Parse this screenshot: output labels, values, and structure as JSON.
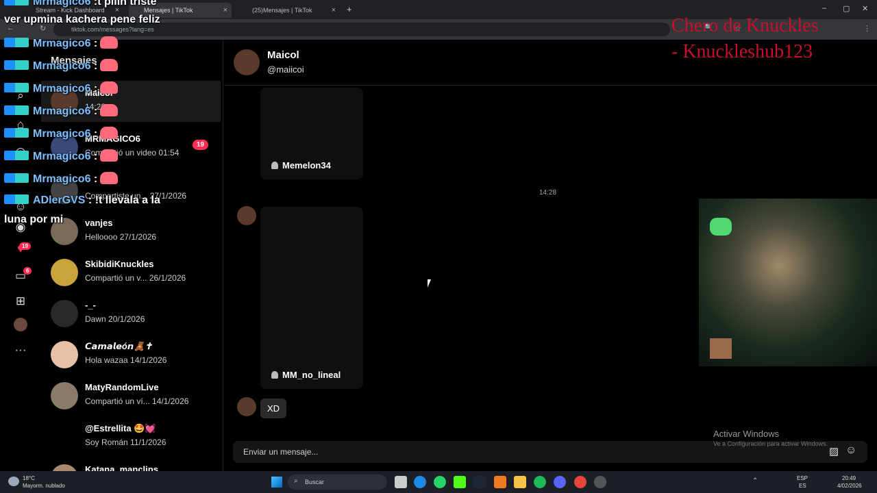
{
  "browser": {
    "tabs": [
      {
        "label": "Stream - Kick Dashboard"
      },
      {
        "label": "Mensajes | TikTok"
      },
      {
        "label": "(25)Mensajes | TikTok"
      }
    ],
    "url": "tiktok.com/messages?lang=es"
  },
  "nav": {
    "likes_badge": "19",
    "messages_badge": "6"
  },
  "sidebar": {
    "header": "Mensajes",
    "conversations": [
      {
        "name": "Maicol",
        "preview": "14:28"
      },
      {
        "name": "MRMAGICO6",
        "preview": "Compartió un video 01:54",
        "badge": "19"
      },
      {
        "name": "",
        "preview": "Compartiste un... 27/1/2026"
      },
      {
        "name": "vanjes",
        "preview": "Helloooo 27/1/2026"
      },
      {
        "name": "SkibidiKnuckles",
        "preview": "Compartió un v... 26/1/2026"
      },
      {
        "name": "-_-",
        "preview": "Dawn 20/1/2026"
      },
      {
        "name": "𝘾𝙖𝙢𝙖𝙡𝙚ó𝙣🧸✝",
        "preview": "Hola wazaa 14/1/2026"
      },
      {
        "name": "MatyRandomLive",
        "preview": "Compartió un ví... 14/1/2026"
      },
      {
        "name": "@Estrellita 🤩💓",
        "preview": "Soy Román 11/1/2026"
      },
      {
        "name": "Katana_manclips",
        "preview": ""
      }
    ]
  },
  "chat": {
    "name": "Maicol",
    "handle": "@maiicoi",
    "messages": [
      {
        "sender": "Memelon34"
      },
      {
        "time": "14:28"
      },
      {
        "sender": "MM_no_lineal"
      },
      {
        "text": "XD"
      }
    ],
    "input_placeholder": "Enviar un mensaje..."
  },
  "overlay": {
    "top_line": ":t pilin triste",
    "top_user": "Mrmagico6",
    "line2": "ver upmina kachera pene feliz",
    "repeat_user": "Mrmagico6",
    "repeat_sep": ":",
    "last_user": "ADlerGVS",
    "last_text": ": !t llevala a la",
    "last_text2": "luna por mi",
    "watermark1": "Chero de Knuckles",
    "watermark2": "- Knuckleshub123",
    "windows_title": "Activar Windows",
    "windows_sub": "Ve a Configuración para activar Windows."
  },
  "taskbar": {
    "temp": "18°C",
    "weather": "Mayorm. nublado",
    "search": "Buscar",
    "lang1": "ESP",
    "lang2": "ES",
    "time": "20:49",
    "date": "4/02/2026"
  }
}
